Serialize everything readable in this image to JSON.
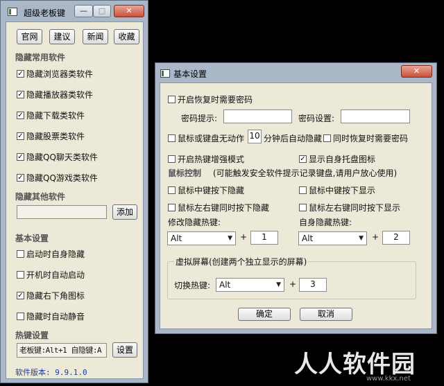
{
  "main_window": {
    "title": "超级老板键",
    "controls": {
      "minimize": "—",
      "maximize": "□",
      "close": "✕"
    },
    "top_buttons": [
      "官网",
      "建议",
      "新闻",
      "收藏"
    ],
    "section_common": "隐藏常用软件",
    "common_items": [
      {
        "label": "隐藏浏览器类软件",
        "checked": true
      },
      {
        "label": "隐藏播放器类软件",
        "checked": true
      },
      {
        "label": "隐藏下载类软件",
        "checked": true
      },
      {
        "label": "隐藏股票类软件",
        "checked": true
      },
      {
        "label": "隐藏QQ聊天类软件",
        "checked": true
      },
      {
        "label": "隐藏QQ游戏类软件",
        "checked": true
      }
    ],
    "section_other": "隐藏其他软件",
    "other_input_value": "",
    "add_button": "添加",
    "section_basic": "基本设置",
    "basic_items": [
      {
        "label": "启动时自身隐藏",
        "checked": false
      },
      {
        "label": "开机时自动启动",
        "checked": false
      },
      {
        "label": "隐藏右下角图标",
        "checked": true
      },
      {
        "label": "隐藏时自动静音",
        "checked": false
      }
    ],
    "section_hotkey": "热键设置",
    "hotkey_display": "老板键:Alt+1 自隐键:A",
    "settings_button": "设置",
    "version_text": "软件版本: 9.9.1.0"
  },
  "dialog": {
    "title": "基本设置",
    "controls": {
      "close": "✕"
    },
    "password_required": {
      "label": "开启恢复时需要密码",
      "checked": false
    },
    "password_hint_label": "密码提示:",
    "password_hint_value": "",
    "password_set_label": "密码设置:",
    "password_set_value": "",
    "idle_autohide": {
      "label": "鼠标或键盘无动作",
      "checked": false
    },
    "idle_minutes": "10",
    "idle_suffix": "分钟后自动隐藏",
    "restore_password": {
      "label": "同时恢复时需要密码",
      "checked": false
    },
    "hotkey_enhance": {
      "label": "开启热键增强模式",
      "checked": false
    },
    "show_tray": {
      "label": "显示自身托盘图标",
      "checked": true
    },
    "mouse_control_title": "鼠标控制",
    "mouse_control_note": "(可能触发安全软件提示记录键盘,请用户放心使用)",
    "mouse_items": [
      {
        "label": "鼠标中键按下隐藏",
        "checked": false
      },
      {
        "label": "鼠标中键按下显示",
        "checked": false
      },
      {
        "label": "鼠标左右键同时按下隐藏",
        "checked": false
      },
      {
        "label": "鼠标左右键同时按下显示",
        "checked": false
      }
    ],
    "hide_hotkey_label": "修改隐藏热键:",
    "hide_hotkey_modifier": "Alt",
    "hide_hotkey_key": "1",
    "self_hotkey_label": "自身隐藏热键:",
    "self_hotkey_modifier": "Alt",
    "self_hotkey_key": "2",
    "plus": "+",
    "virtual_screen_title": "虚拟屏幕(创建两个独立显示的屏幕)",
    "switch_hotkey_label": "切换热键:",
    "switch_hotkey_modifier": "Alt",
    "switch_hotkey_key": "3",
    "ok_button": "确定",
    "cancel_button": "取消"
  },
  "watermark": {
    "text": "人人软件园",
    "url": "www.kkx.net"
  }
}
